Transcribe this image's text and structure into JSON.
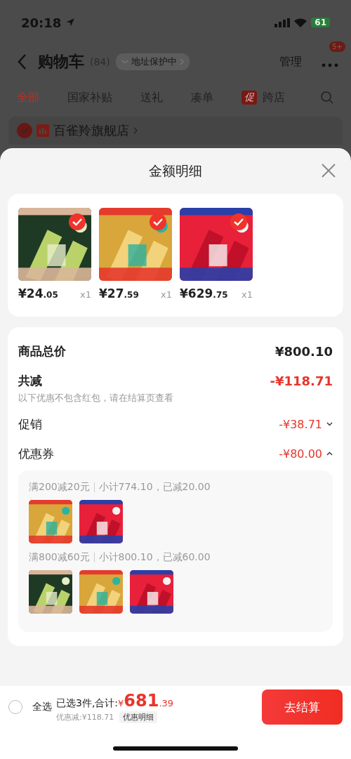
{
  "status_bar": {
    "time": "20:18",
    "battery": "61"
  },
  "header": {
    "title": "购物车",
    "count": "(84)",
    "address": "地址保护中",
    "manage": "管理",
    "badge": "5+"
  },
  "tabs": [
    {
      "label": "全部",
      "selected": true,
      "kind": "plain"
    },
    {
      "label": "国家补贴",
      "selected": false,
      "kind": "plain"
    },
    {
      "label": "送礼",
      "selected": false,
      "kind": "plain"
    },
    {
      "label": "凑单",
      "selected": false,
      "kind": "plain"
    },
    {
      "label": "跨店",
      "selected": false,
      "kind": "promo",
      "tag": "促"
    }
  ],
  "store": {
    "name": "百雀羚旗舰店",
    "checked": true
  },
  "sheet": {
    "title": "金额明细",
    "products": [
      {
        "kind": "picture",
        "checked": true,
        "price": "¥24",
        "decimal": ".05",
        "qty": "x1"
      },
      {
        "kind": "picture",
        "checked": true,
        "price": "¥27",
        "decimal": ".59",
        "qty": "x1"
      },
      {
        "kind": "picture",
        "checked": true,
        "price": "¥629",
        "decimal": ".75",
        "qty": "x1"
      }
    ],
    "rows": [
      {
        "kind": "total",
        "label": "商品总价",
        "value": "¥800.10"
      },
      {
        "kind": "discount",
        "label": "共减",
        "value": "-¥118.71",
        "note": "以下优惠不包含红包，请在结算页查看"
      },
      {
        "kind": "detail",
        "label": "促销",
        "value": "-¥38.71",
        "expanded": false
      },
      {
        "kind": "detail",
        "label": "优惠券",
        "value": "-¥80.00",
        "expanded": true
      }
    ],
    "coupons": [
      {
        "rule": "满200减20元",
        "summary": "小计774.10，已减20.00"
      },
      {
        "rule": "满800减60元",
        "summary": "小计800.10，已减60.00"
      }
    ]
  },
  "bottom_bar": {
    "select_all": {
      "label": "全选",
      "checked": false
    },
    "summary": "已选3件,合计:",
    "currency": "¥",
    "total": "681",
    "decimal": ".39",
    "discount": "优惠减:¥118.71",
    "detail_button": "优惠明细",
    "checkout": "去结算"
  }
}
